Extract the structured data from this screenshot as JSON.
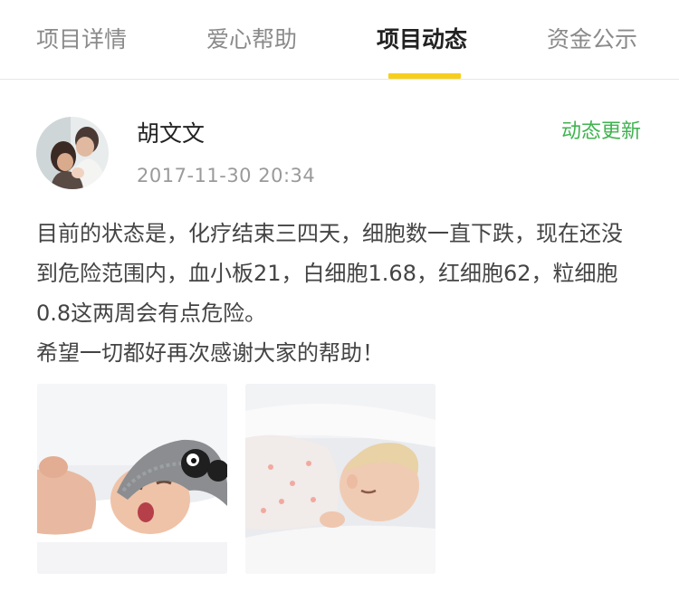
{
  "tabs": [
    {
      "label": "项目详情",
      "active": false
    },
    {
      "label": "爱心帮助",
      "active": false
    },
    {
      "label": "项目动态",
      "active": true
    },
    {
      "label": "资金公示",
      "active": false
    }
  ],
  "colors": {
    "active_indicator": "#f6cf1d",
    "update_link": "#3fb34f",
    "tab_inactive": "#8a8a8a"
  },
  "post": {
    "author": "胡文文",
    "timestamp": "2017-11-30 20:34",
    "update_label": "动态更新",
    "body_paragraph_1": "目前的状态是，化疗结束三四天，细胞数一直下跌，现在还没到危险范围内，血小板21，白细胞1.68，红细胞62，粒细胞0.8这两周会有点危险。",
    "body_paragraph_2": "希望一切都好再次感谢大家的帮助！",
    "photos": [
      {
        "icon": "baby-photo-crying"
      },
      {
        "icon": "baby-photo-sleeping"
      }
    ]
  }
}
